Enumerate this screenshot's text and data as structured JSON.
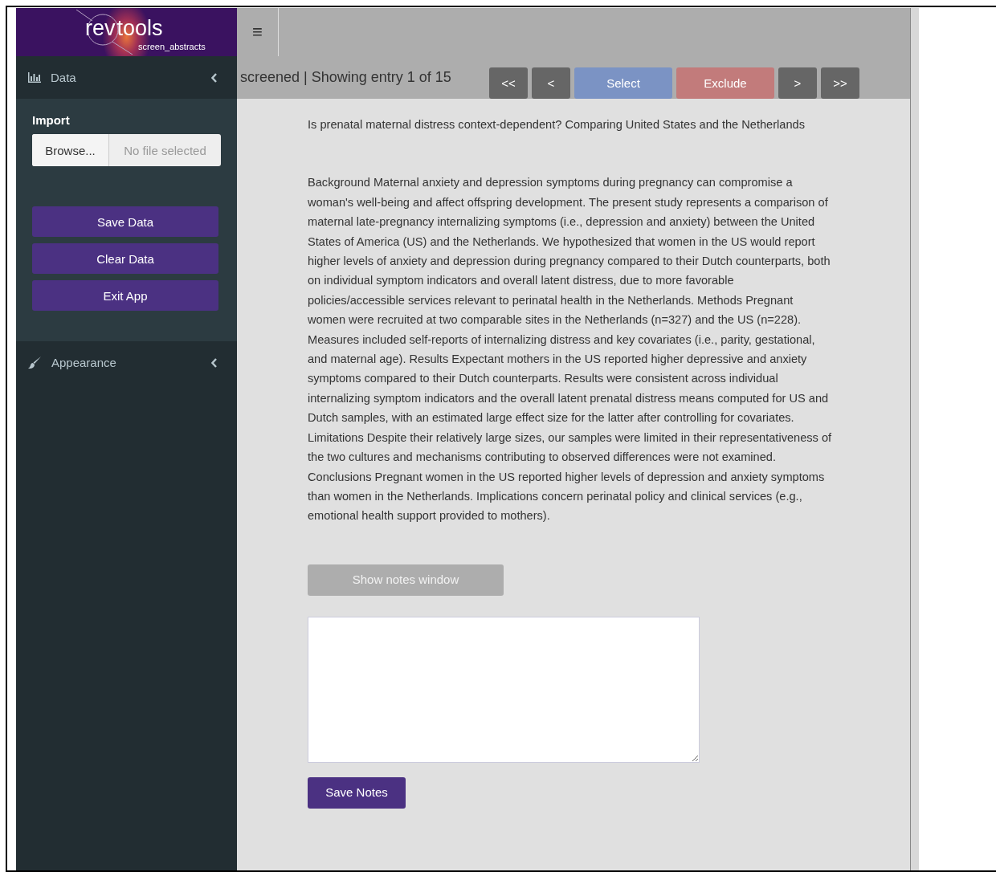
{
  "logo": {
    "left": "rev",
    "right": "tools",
    "subtitle": "screen_abstracts"
  },
  "sidebar": {
    "data_menu": {
      "label": "Data"
    },
    "import": {
      "label": "Import",
      "browse": "Browse...",
      "placeholder": "No file selected"
    },
    "buttons": [
      "Save Data",
      "Clear Data",
      "Exit App"
    ],
    "appearance_menu": {
      "label": "Appearance"
    }
  },
  "header": {
    "menu_icon": "≡"
  },
  "status": "screened | Showing entry 1 of 15",
  "nav_buttons": [
    {
      "label": "<<",
      "kind": "nav"
    },
    {
      "label": "<",
      "kind": "nav"
    },
    {
      "label": "Select",
      "kind": "select"
    },
    {
      "label": "Exclude",
      "kind": "exclude"
    },
    {
      "label": ">",
      "kind": "nav"
    },
    {
      "label": ">>",
      "kind": "nav"
    }
  ],
  "article": {
    "title": "Is prenatal maternal distress context-dependent? Comparing United States and the Netherlands",
    "abstract": "Background Maternal anxiety and depression symptoms during pregnancy can compromise a woman's well-being and affect offspring development. The present study represents a comparison of maternal late-pregnancy internalizing symptoms (i.e., depression and anxiety) between the United States of America (US) and the Netherlands. We hypothesized that women in the US would report higher levels of anxiety and depression during pregnancy compared to their Dutch counterparts, both on individual symptom indicators and overall latent distress, due to more favorable policies/accessible services relevant to perinatal health in the Netherlands. Methods Pregnant women were recruited at two comparable sites in the Netherlands (n=327) and the US (n=228). Measures included self-reports of internalizing distress and key covariates (i.e., parity, gestational, and maternal age). Results Expectant mothers in the US reported higher depressive and anxiety symptoms compared to their Dutch counterparts. Results were consistent across individual internalizing symptom indicators and the overall latent prenatal distress means computed for US and Dutch samples, with an estimated large effect size for the latter after controlling for covariates. Limitations Despite their relatively large sizes, our samples were limited in their representativeness of the two cultures and mechanisms contributing to observed differences were not examined. Conclusions Pregnant women in the US reported higher levels of depression and anxiety symptoms than women in the Netherlands. Implications concern perinatal policy and clinical services (e.g., emotional health support provided to mothers)."
  },
  "notes": {
    "show_button": "Show notes window",
    "save_button": "Save Notes"
  }
}
